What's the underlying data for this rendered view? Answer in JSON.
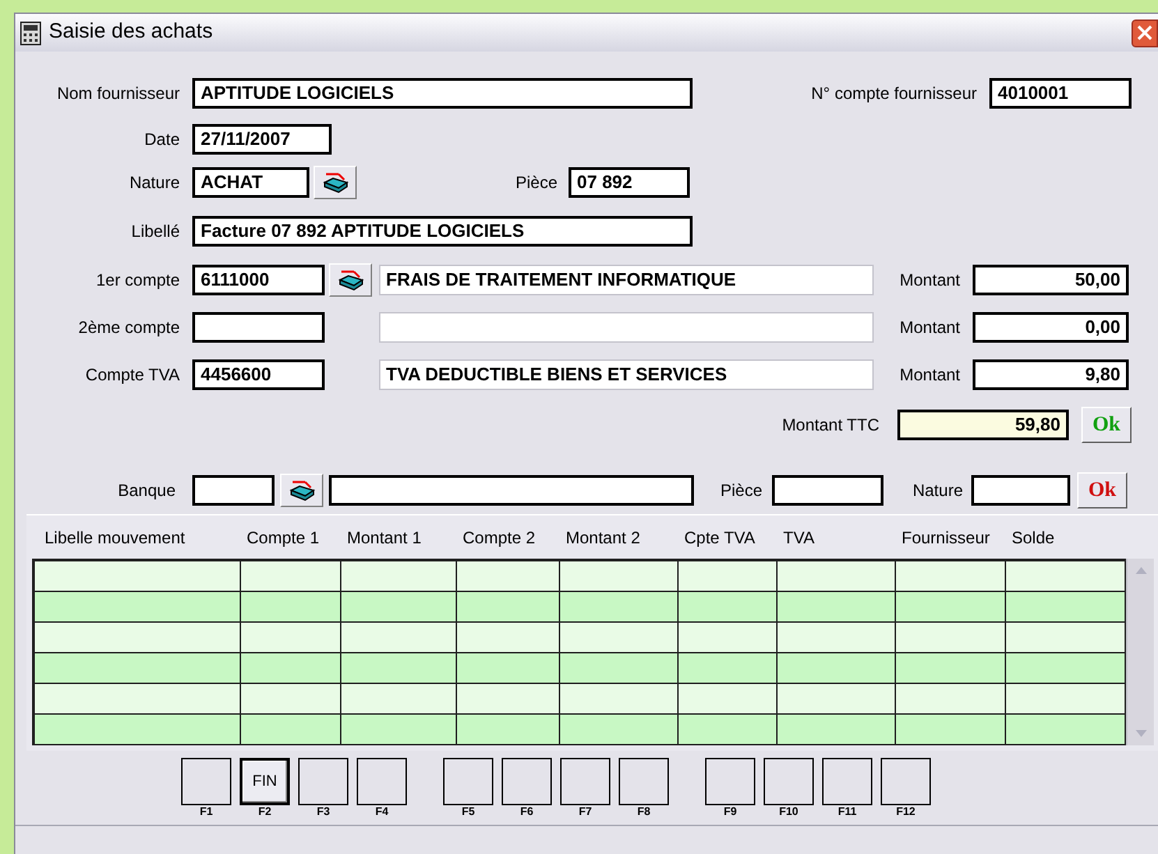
{
  "window": {
    "title": "Saisie des achats"
  },
  "supplier": {
    "name_label": "Nom fournisseur",
    "name": "APTITUDE LOGICIELS",
    "account_label": "N° compte fournisseur",
    "account": "4010001"
  },
  "date": {
    "label": "Date",
    "value": "27/11/2007"
  },
  "nature": {
    "label": "Nature",
    "value": "ACHAT"
  },
  "piece": {
    "label": "Pièce",
    "value": "07 892"
  },
  "libelle": {
    "label": "Libellé",
    "value": "Facture 07 892 APTITUDE LOGICIELS"
  },
  "accounts": [
    {
      "label": "1er compte",
      "account": "6111000",
      "lookup": true,
      "description": "FRAIS DE TRAITEMENT INFORMATIQUE",
      "amount_label": "Montant",
      "amount": "50,00"
    },
    {
      "label": "2ème compte",
      "lookup": false,
      "amount_label": "Montant",
      "amount": "0,00"
    },
    {
      "label": "Compte TVA",
      "account": "4456600",
      "lookup": false,
      "description": "TVA DEDUCTIBLE BIENS ET SERVICES",
      "amount_label": "Montant",
      "amount": "9,80"
    }
  ],
  "total": {
    "label": "Montant TTC",
    "value": "59,80",
    "ok": "Ok"
  },
  "bank": {
    "label": "Banque",
    "piece_label": "Pièce",
    "nature_label": "Nature",
    "ok": "Ok"
  },
  "grid": {
    "columns": [
      "Libelle mouvement",
      "Compte 1",
      "Montant 1",
      "Compte 2",
      "Montant 2",
      "Cpte TVA",
      "TVA",
      "Fournisseur",
      "Solde"
    ]
  },
  "function_keys": [
    {
      "key": "F1"
    },
    {
      "key": "F2",
      "caption": "FIN"
    },
    {
      "key": "F3"
    },
    {
      "key": "F4"
    },
    {
      "key": "F5"
    },
    {
      "key": "F6"
    },
    {
      "key": "F7"
    },
    {
      "key": "F8"
    },
    {
      "key": "F9"
    },
    {
      "key": "F10"
    },
    {
      "key": "F11"
    },
    {
      "key": "F12"
    }
  ]
}
